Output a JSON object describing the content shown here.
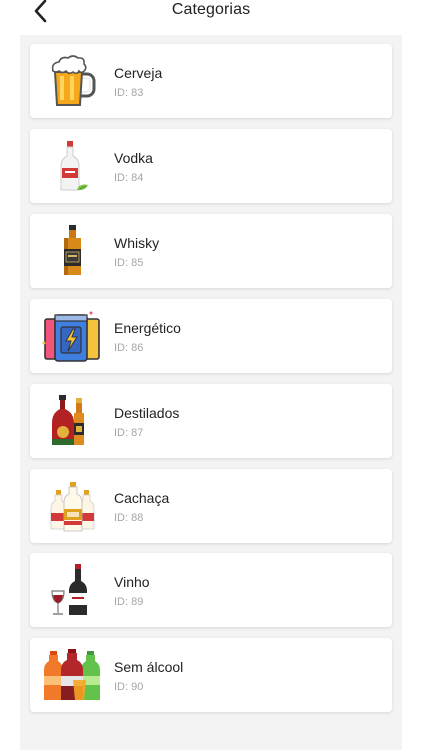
{
  "header": {
    "title": "Categorias"
  },
  "categories": [
    {
      "name": "Cerveja",
      "id_label": "ID: 83",
      "icon": "beer-mug-icon"
    },
    {
      "name": "Vodka",
      "id_label": "ID: 84",
      "icon": "vodka-bottle-icon"
    },
    {
      "name": "Whisky",
      "id_label": "ID: 85",
      "icon": "whisky-bottle-icon"
    },
    {
      "name": "Energético",
      "id_label": "ID: 86",
      "icon": "energy-drink-cans-icon"
    },
    {
      "name": "Destilados",
      "id_label": "ID: 87",
      "icon": "liquor-bottles-icon"
    },
    {
      "name": "Cachaça",
      "id_label": "ID: 88",
      "icon": "cachaca-bottles-icon"
    },
    {
      "name": "Vinho",
      "id_label": "ID: 89",
      "icon": "wine-bottle-glass-icon"
    },
    {
      "name": "Sem álcool",
      "id_label": "ID: 90",
      "icon": "soda-bottles-icon"
    }
  ]
}
